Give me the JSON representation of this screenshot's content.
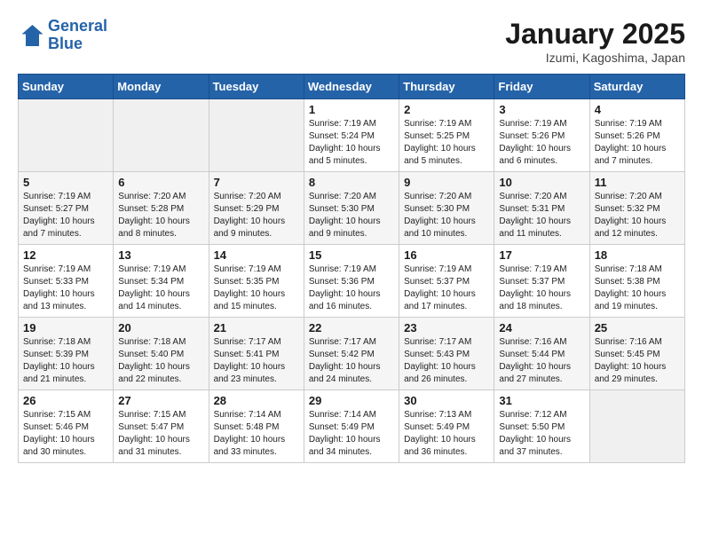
{
  "logo": {
    "line1": "General",
    "line2": "Blue"
  },
  "title": "January 2025",
  "subtitle": "Izumi, Kagoshima, Japan",
  "days_of_week": [
    "Sunday",
    "Monday",
    "Tuesday",
    "Wednesday",
    "Thursday",
    "Friday",
    "Saturday"
  ],
  "weeks": [
    [
      {
        "day": "",
        "info": ""
      },
      {
        "day": "",
        "info": ""
      },
      {
        "day": "",
        "info": ""
      },
      {
        "day": "1",
        "info": "Sunrise: 7:19 AM\nSunset: 5:24 PM\nDaylight: 10 hours\nand 5 minutes."
      },
      {
        "day": "2",
        "info": "Sunrise: 7:19 AM\nSunset: 5:25 PM\nDaylight: 10 hours\nand 5 minutes."
      },
      {
        "day": "3",
        "info": "Sunrise: 7:19 AM\nSunset: 5:26 PM\nDaylight: 10 hours\nand 6 minutes."
      },
      {
        "day": "4",
        "info": "Sunrise: 7:19 AM\nSunset: 5:26 PM\nDaylight: 10 hours\nand 7 minutes."
      }
    ],
    [
      {
        "day": "5",
        "info": "Sunrise: 7:19 AM\nSunset: 5:27 PM\nDaylight: 10 hours\nand 7 minutes."
      },
      {
        "day": "6",
        "info": "Sunrise: 7:20 AM\nSunset: 5:28 PM\nDaylight: 10 hours\nand 8 minutes."
      },
      {
        "day": "7",
        "info": "Sunrise: 7:20 AM\nSunset: 5:29 PM\nDaylight: 10 hours\nand 9 minutes."
      },
      {
        "day": "8",
        "info": "Sunrise: 7:20 AM\nSunset: 5:30 PM\nDaylight: 10 hours\nand 9 minutes."
      },
      {
        "day": "9",
        "info": "Sunrise: 7:20 AM\nSunset: 5:30 PM\nDaylight: 10 hours\nand 10 minutes."
      },
      {
        "day": "10",
        "info": "Sunrise: 7:20 AM\nSunset: 5:31 PM\nDaylight: 10 hours\nand 11 minutes."
      },
      {
        "day": "11",
        "info": "Sunrise: 7:20 AM\nSunset: 5:32 PM\nDaylight: 10 hours\nand 12 minutes."
      }
    ],
    [
      {
        "day": "12",
        "info": "Sunrise: 7:19 AM\nSunset: 5:33 PM\nDaylight: 10 hours\nand 13 minutes."
      },
      {
        "day": "13",
        "info": "Sunrise: 7:19 AM\nSunset: 5:34 PM\nDaylight: 10 hours\nand 14 minutes."
      },
      {
        "day": "14",
        "info": "Sunrise: 7:19 AM\nSunset: 5:35 PM\nDaylight: 10 hours\nand 15 minutes."
      },
      {
        "day": "15",
        "info": "Sunrise: 7:19 AM\nSunset: 5:36 PM\nDaylight: 10 hours\nand 16 minutes."
      },
      {
        "day": "16",
        "info": "Sunrise: 7:19 AM\nSunset: 5:37 PM\nDaylight: 10 hours\nand 17 minutes."
      },
      {
        "day": "17",
        "info": "Sunrise: 7:19 AM\nSunset: 5:37 PM\nDaylight: 10 hours\nand 18 minutes."
      },
      {
        "day": "18",
        "info": "Sunrise: 7:18 AM\nSunset: 5:38 PM\nDaylight: 10 hours\nand 19 minutes."
      }
    ],
    [
      {
        "day": "19",
        "info": "Sunrise: 7:18 AM\nSunset: 5:39 PM\nDaylight: 10 hours\nand 21 minutes."
      },
      {
        "day": "20",
        "info": "Sunrise: 7:18 AM\nSunset: 5:40 PM\nDaylight: 10 hours\nand 22 minutes."
      },
      {
        "day": "21",
        "info": "Sunrise: 7:17 AM\nSunset: 5:41 PM\nDaylight: 10 hours\nand 23 minutes."
      },
      {
        "day": "22",
        "info": "Sunrise: 7:17 AM\nSunset: 5:42 PM\nDaylight: 10 hours\nand 24 minutes."
      },
      {
        "day": "23",
        "info": "Sunrise: 7:17 AM\nSunset: 5:43 PM\nDaylight: 10 hours\nand 26 minutes."
      },
      {
        "day": "24",
        "info": "Sunrise: 7:16 AM\nSunset: 5:44 PM\nDaylight: 10 hours\nand 27 minutes."
      },
      {
        "day": "25",
        "info": "Sunrise: 7:16 AM\nSunset: 5:45 PM\nDaylight: 10 hours\nand 29 minutes."
      }
    ],
    [
      {
        "day": "26",
        "info": "Sunrise: 7:15 AM\nSunset: 5:46 PM\nDaylight: 10 hours\nand 30 minutes."
      },
      {
        "day": "27",
        "info": "Sunrise: 7:15 AM\nSunset: 5:47 PM\nDaylight: 10 hours\nand 31 minutes."
      },
      {
        "day": "28",
        "info": "Sunrise: 7:14 AM\nSunset: 5:48 PM\nDaylight: 10 hours\nand 33 minutes."
      },
      {
        "day": "29",
        "info": "Sunrise: 7:14 AM\nSunset: 5:49 PM\nDaylight: 10 hours\nand 34 minutes."
      },
      {
        "day": "30",
        "info": "Sunrise: 7:13 AM\nSunset: 5:49 PM\nDaylight: 10 hours\nand 36 minutes."
      },
      {
        "day": "31",
        "info": "Sunrise: 7:12 AM\nSunset: 5:50 PM\nDaylight: 10 hours\nand 37 minutes."
      },
      {
        "day": "",
        "info": ""
      }
    ]
  ]
}
